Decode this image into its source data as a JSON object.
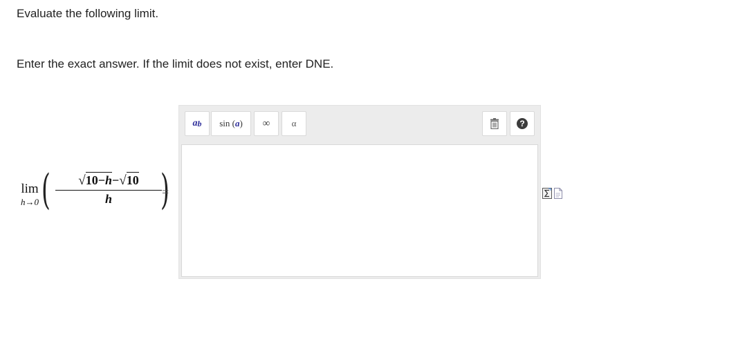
{
  "question": {
    "prompt": "Evaluate the following limit.",
    "instructions": "Enter the exact answer. If the limit does not exist, enter DNE."
  },
  "expression": {
    "lim_word": "lim",
    "lim_var": "h",
    "lim_arrow": "→",
    "lim_target": "0",
    "left_paren": "(",
    "right_paren": ")",
    "radical": "√",
    "num_a": "10",
    "minus": "−",
    "num_var": "h",
    "num_b": "10",
    "denominator": "h",
    "equals": "="
  },
  "editor": {
    "toolbar": {
      "power": {
        "base": "a",
        "exp": "b"
      },
      "sin": {
        "func": "sin",
        "open": "(",
        "arg": "a",
        "close": ")"
      },
      "infinity": "∞",
      "alpha": "α",
      "trash_icon": "trash-icon",
      "help": "?"
    },
    "answer_value": "",
    "answer_placeholder": ""
  },
  "side_icons": [
    "sigma-icon",
    "document-icon"
  ],
  "colors": {
    "toolbar_bg": "#ececec",
    "math_accent": "#2d2d9a",
    "help_bg": "#3c3c3c"
  }
}
